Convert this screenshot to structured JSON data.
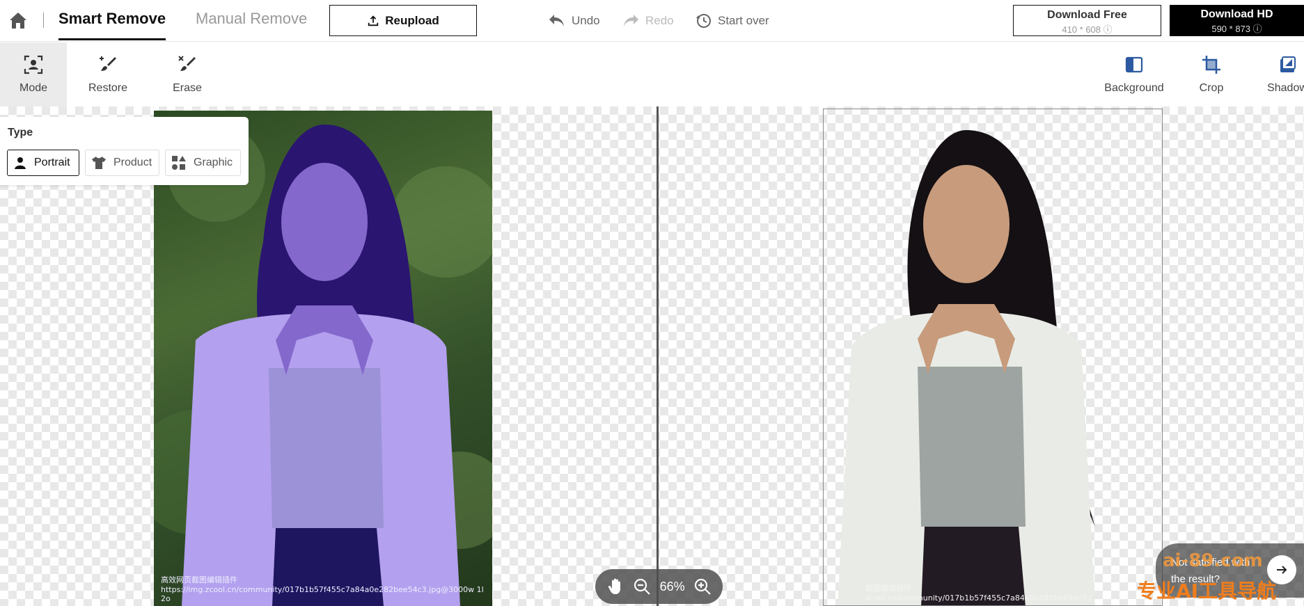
{
  "header": {
    "tabs": [
      {
        "label": "Smart Remove",
        "active": true
      },
      {
        "label": "Manual Remove",
        "active": false
      }
    ],
    "reupload_label": "Reupload",
    "history": {
      "undo": "Undo",
      "redo": "Redo",
      "start_over": "Start over"
    },
    "download_free": {
      "label": "Download Free",
      "size": "410 * 608"
    },
    "download_hd": {
      "label": "Download HD",
      "size": "590 * 873"
    }
  },
  "toolbar": {
    "left_tools": [
      {
        "label": "Mode",
        "icon": "mode-icon",
        "active": true
      },
      {
        "label": "Restore",
        "icon": "restore-brush-icon",
        "active": false
      },
      {
        "label": "Erase",
        "icon": "erase-brush-icon",
        "active": false
      }
    ],
    "right_tools": [
      {
        "label": "Background",
        "icon": "background-icon"
      },
      {
        "label": "Crop",
        "icon": "crop-icon"
      },
      {
        "label": "Shadow",
        "icon": "shadow-icon"
      }
    ]
  },
  "type_panel": {
    "label": "Type",
    "options": [
      {
        "label": "Portrait",
        "icon": "portrait-icon",
        "selected": true
      },
      {
        "label": "Product",
        "icon": "shirt-icon",
        "selected": false
      },
      {
        "label": "Graphic",
        "icon": "shapes-icon",
        "selected": false
      }
    ]
  },
  "images": {
    "left_watermark": "高效网页截图编辑插件\nhttps://img.zcool.cn/community/017b1b57f455c7a84a0e282bee54c3.jpg@3000w 1l 2o",
    "right_watermark": "截图编辑插件\nzcool.cn/community/017b1b57f455c7a84a0e282bee54c3.j"
  },
  "zoom": {
    "level": "66%"
  },
  "feedback": {
    "text": "Not satisfied with the result?"
  },
  "overlay_brand": {
    "top": "ai-89.com",
    "bottom": "专业AI工具导航"
  },
  "colors": {
    "accent": "#000000",
    "selection_tint": "#3a1fd8",
    "checker": "#e8e8e8"
  }
}
